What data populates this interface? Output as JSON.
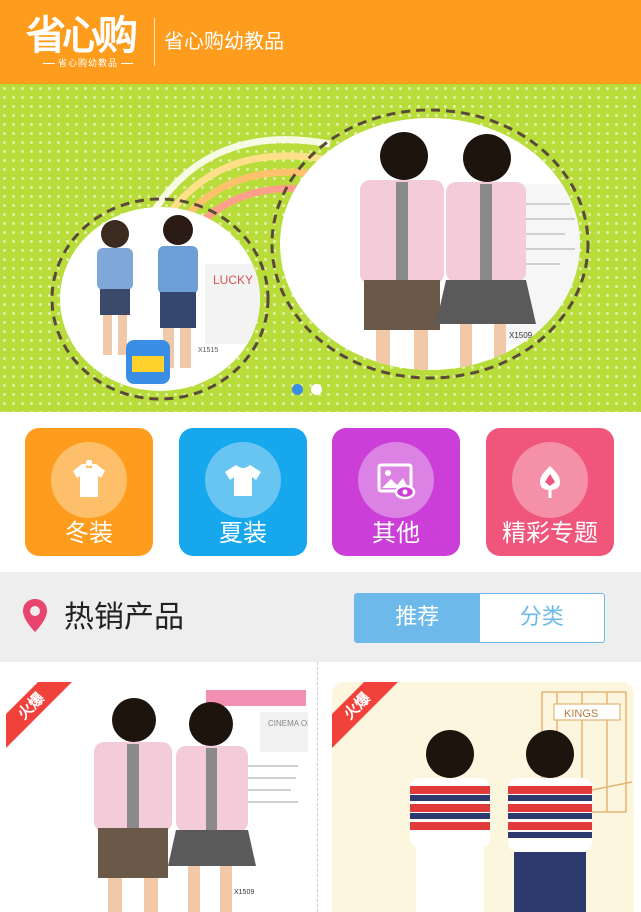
{
  "header": {
    "logo_glyphs": "省心购",
    "logo_sub": "省心购幼教品",
    "title": "省心购幼教品",
    "background": "#fe9d1d"
  },
  "banner": {
    "background": "#b8dc3a",
    "slides_total": 2,
    "active_slide": 1,
    "price_tag_left": "X1515",
    "price_tag_right": "X1509",
    "brand_text": "LUCKY"
  },
  "categories": [
    {
      "label": "冬装",
      "icon": "shirt-icon",
      "color": "#fe9d1d"
    },
    {
      "label": "夏装",
      "icon": "tshirt-icon",
      "color": "#17a7ec"
    },
    {
      "label": "其他",
      "icon": "image-icon",
      "color": "#cb3fd8"
    },
    {
      "label": "精彩专题",
      "icon": "flower-icon",
      "color": "#f0557b"
    }
  ],
  "hot_section": {
    "title": "热销产品",
    "tabs": [
      {
        "label": "推荐",
        "active": true
      },
      {
        "label": "分类",
        "active": false
      }
    ],
    "accent": "#6cb9ea",
    "pin_color": "#e8456e"
  },
  "products": [
    {
      "tag": "火爆",
      "poster_text": "CINEMA OF LOVE",
      "price_tag": "X1509"
    },
    {
      "tag": "火爆",
      "poster_text": "KINGS",
      "script_text": "est"
    }
  ]
}
